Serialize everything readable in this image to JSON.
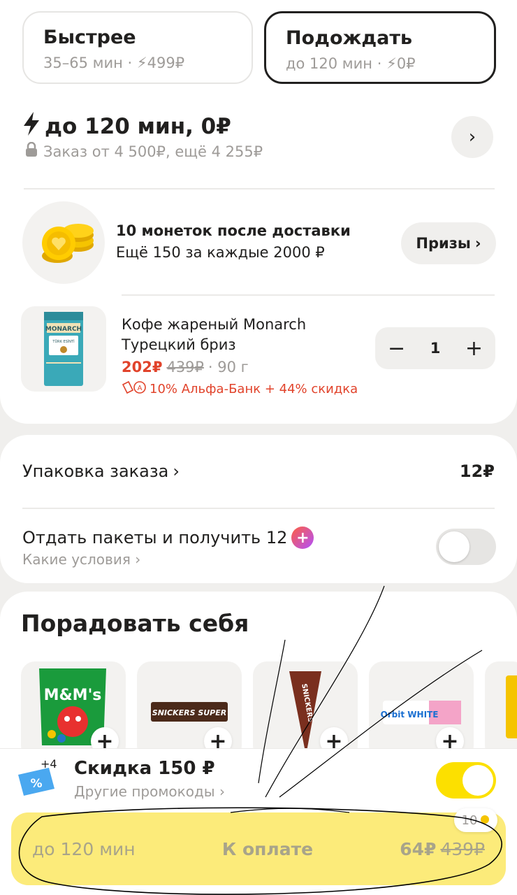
{
  "delivery_options": [
    {
      "title": "Быстрее",
      "time": "35–65 мин",
      "fee": "499₽",
      "selected": false
    },
    {
      "title": "Подождать",
      "time": "до 120 мин",
      "fee": "0₽",
      "selected": true
    }
  ],
  "summary": {
    "title": "до 120 мин, 0₽",
    "min_order": "Заказ от 4 500₽, ещё 4 255₽"
  },
  "coins": {
    "line1": "10 монеток после доставки",
    "line2": "Ещё 150 за каждые 2000 ₽",
    "prizes_label": "Призы"
  },
  "product": {
    "name": "Кофе жареный Monarch Турецкий бриз",
    "price_new": "202₽",
    "price_old": "439₽",
    "weight": "· 90 г",
    "promo": "10% Альфа-Банк + 44% скидка",
    "quantity": "1",
    "package_text": "MONARCH",
    "package_sub": "TÜRK ESİNTİ"
  },
  "packing": {
    "label": "Упаковка заказа",
    "price": "12₽"
  },
  "bags": {
    "label": "Отдать пакеты и получить 12",
    "sub": "Какие условия"
  },
  "treat": {
    "title": "Порадовать себя",
    "items": [
      "M&M's",
      "SNICKERS SUPER",
      "SNICKERS",
      "Orbit WHITE"
    ]
  },
  "promo": {
    "badge": "+4",
    "title": "Скидка 150 ₽",
    "sub": "Другие промокоды"
  },
  "coins_pill": "10",
  "pay": {
    "time": "до 120 мин",
    "label": "К оплате",
    "price": "64₽",
    "price_old": "439₽"
  },
  "colors": {
    "accent": "#fce000",
    "discount": "#e1432b",
    "muted": "#9e9b98"
  }
}
